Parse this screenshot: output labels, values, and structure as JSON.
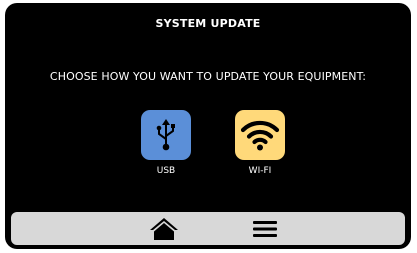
{
  "header": {
    "title": "SYSTEM UPDATE"
  },
  "main": {
    "prompt": "CHOOSE HOW YOU WANT TO UPDATE YOUR EQUIPMENT:",
    "options": [
      {
        "label": "USB",
        "icon": "usb-icon",
        "color": "#5b8fd8"
      },
      {
        "label": "WI-FI",
        "icon": "wifi-icon",
        "color": "#ffd97a"
      }
    ]
  },
  "navbar": {
    "items": [
      {
        "icon": "home-icon"
      },
      {
        "icon": "menu-icon"
      }
    ],
    "background": "#d8d8d8"
  },
  "colors": {
    "screen_background": "#000000",
    "text": "#ffffff"
  }
}
